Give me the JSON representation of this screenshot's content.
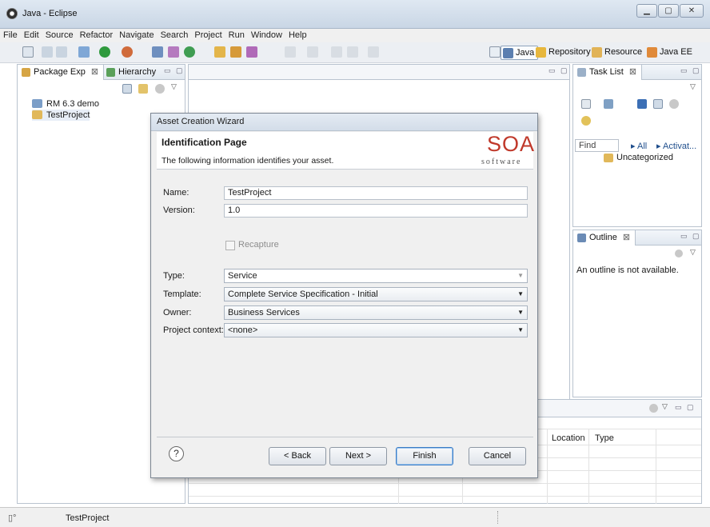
{
  "window": {
    "title": "Java - Eclipse"
  },
  "menu": [
    "File",
    "Edit",
    "Source",
    "Refactor",
    "Navigate",
    "Search",
    "Project",
    "Run",
    "Window",
    "Help"
  ],
  "perspectives": [
    {
      "label": "Java",
      "icon": "java-perspective-icon"
    },
    {
      "label": "Repository",
      "icon": "repository-perspective-icon"
    },
    {
      "label": "Resource",
      "icon": "resource-perspective-icon"
    },
    {
      "label": "Java EE",
      "icon": "javaee-perspective-icon"
    }
  ],
  "left_panel": {
    "tabs": [
      {
        "label": "Package Exp",
        "close": "⊠"
      },
      {
        "label": "Hierarchy"
      }
    ],
    "tree": [
      {
        "label": "RM 6.3 demo"
      },
      {
        "label": "TestProject"
      }
    ]
  },
  "task_panel": {
    "tab": {
      "label": "Task List",
      "close": "⊠"
    },
    "find_placeholder": "Find",
    "filters": [
      "All",
      "Activat..."
    ],
    "category": "Uncategorized"
  },
  "outline_panel": {
    "tab": {
      "label": "Outline",
      "close": "⊠"
    },
    "message": "An outline is not available."
  },
  "bottom_panel": {
    "columns": [
      "Location",
      "Type"
    ]
  },
  "dialog": {
    "title": "Asset Creation Wizard",
    "header_title": "Identification Page",
    "header_desc": "The following information identifies your asset.",
    "logo": {
      "main": "SOA",
      "sub": "software"
    },
    "fields": {
      "name_label": "Name:",
      "name_value": "TestProject",
      "version_label": "Version:",
      "version_value": "1.0",
      "recapture_label": "Recapture",
      "type_label": "Type:",
      "type_value": "Service",
      "template_label": "Template:",
      "template_value": "Complete Service Specification - Initial",
      "owner_label": "Owner:",
      "owner_value": "Business Services",
      "context_label": "Project context:",
      "context_value": "<none>"
    },
    "buttons": {
      "help": "?",
      "back": "< Back",
      "next": "Next >",
      "finish": "Finish",
      "cancel": "Cancel"
    }
  },
  "status": {
    "text": "TestProject"
  },
  "colors": {
    "accent": "#3b7bc4",
    "logo_red": "#c0392b",
    "panel_border": "#b9c3cf"
  }
}
